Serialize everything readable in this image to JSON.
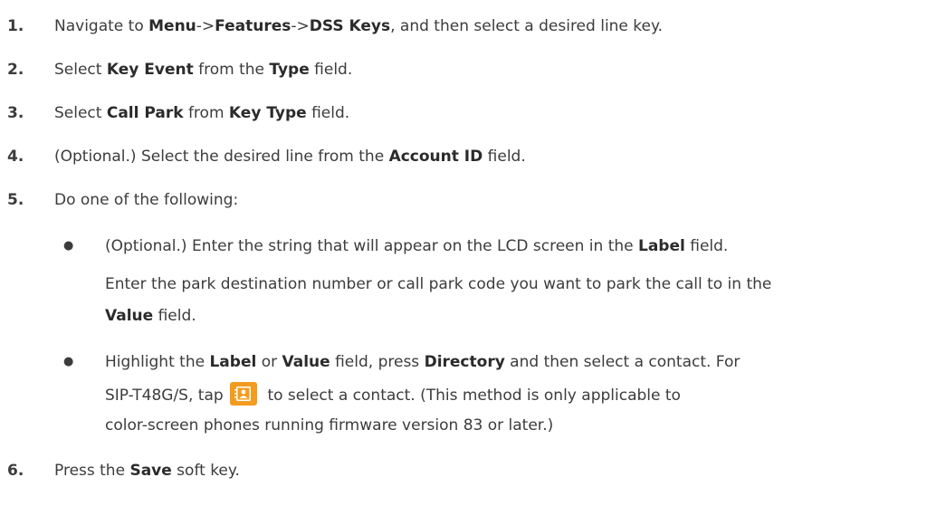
{
  "steps": [
    {
      "num": "1.",
      "parts": [
        "Navigate to ",
        "Menu",
        "->",
        "Features",
        "->",
        "DSS Keys",
        ", and then select a desired line key."
      ]
    },
    {
      "num": "2.",
      "parts": [
        "Select ",
        "Key Event",
        " from the ",
        "Type",
        " field."
      ]
    },
    {
      "num": "3.",
      "parts": [
        "Select ",
        "Call Park",
        " from ",
        "Key Type",
        " field."
      ]
    },
    {
      "num": "4.",
      "parts": [
        "(Optional.) Select the desired line from the ",
        "Account ID",
        " field."
      ]
    },
    {
      "num": "5.",
      "parts": [
        "Do one of the following:"
      ]
    },
    {
      "num": "6.",
      "parts": [
        "Press the ",
        "Save",
        " soft key."
      ]
    }
  ],
  "bullet_glyph": "●",
  "bullet1": {
    "line1": [
      "(Optional.) Enter the string that will appear on the LCD screen in the ",
      "Label",
      " field."
    ],
    "line2": "Enter the park destination number or call park code you want to park the call to in the",
    "line3": [
      "Value",
      " field."
    ]
  },
  "bullet2": {
    "line1": [
      "Highlight the ",
      "Label",
      " or ",
      "Value",
      " field, press ",
      "Directory",
      " and then select a contact. For"
    ],
    "line2a": "SIP-T48G/S, tap ",
    "line2b": " to select a contact. (This method is only applicable to",
    "line3": "color-screen phones running firmware version 83 or later.)"
  },
  "icons": {
    "directory_icon": "contact-book-icon",
    "directory_icon_color": "#f39c1f"
  }
}
